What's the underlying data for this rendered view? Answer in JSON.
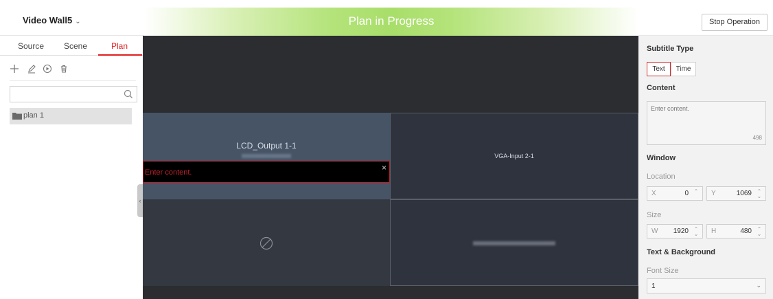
{
  "header": {
    "title": "Video Wall5",
    "title_chevron": "⌄",
    "banner_text": "Plan in Progress",
    "stop_button": "Stop Operation"
  },
  "left_panel": {
    "tabs": [
      {
        "label": "Source"
      },
      {
        "label": "Scene"
      },
      {
        "label": "Plan",
        "active": true
      }
    ],
    "toolbar_icons": [
      "plus-icon",
      "edit-icon",
      "play-icon",
      "delete-icon"
    ],
    "search": {
      "value": "",
      "placeholder": ""
    },
    "plans": [
      {
        "label": "plan 1"
      }
    ]
  },
  "wall": {
    "screens": [
      {
        "name": "LCD_Output 1-1",
        "status": "active"
      },
      {
        "name": "VGA-Input 2-1",
        "status": "active"
      },
      {
        "name": "",
        "status": "disabled"
      },
      {
        "name": "",
        "status": "blurred"
      }
    ],
    "subtitle_text": "Enter content.",
    "subtitle_close": "×"
  },
  "right_panel": {
    "subtitle_type_title": "Subtitle Type",
    "subtitle_types": [
      {
        "label": "Text",
        "active": true
      },
      {
        "label": "Time"
      }
    ],
    "content_title": "Content",
    "content_placeholder": "Enter content.",
    "content_remaining": "498",
    "window_title": "Window",
    "location_label": "Location",
    "location_x_prefix": "X",
    "location_x": "0",
    "location_y_prefix": "Y",
    "location_y": "1069",
    "size_label": "Size",
    "size_w_prefix": "W",
    "size_w": "1920",
    "size_h_prefix": "H",
    "size_h": "480",
    "text_bg_title": "Text & Background",
    "font_size_label": "Font Size",
    "font_size_value": "1"
  },
  "colors": {
    "accent": "#e02020",
    "banner": "#a8de6a",
    "wall_bg": "#2b2d31"
  }
}
